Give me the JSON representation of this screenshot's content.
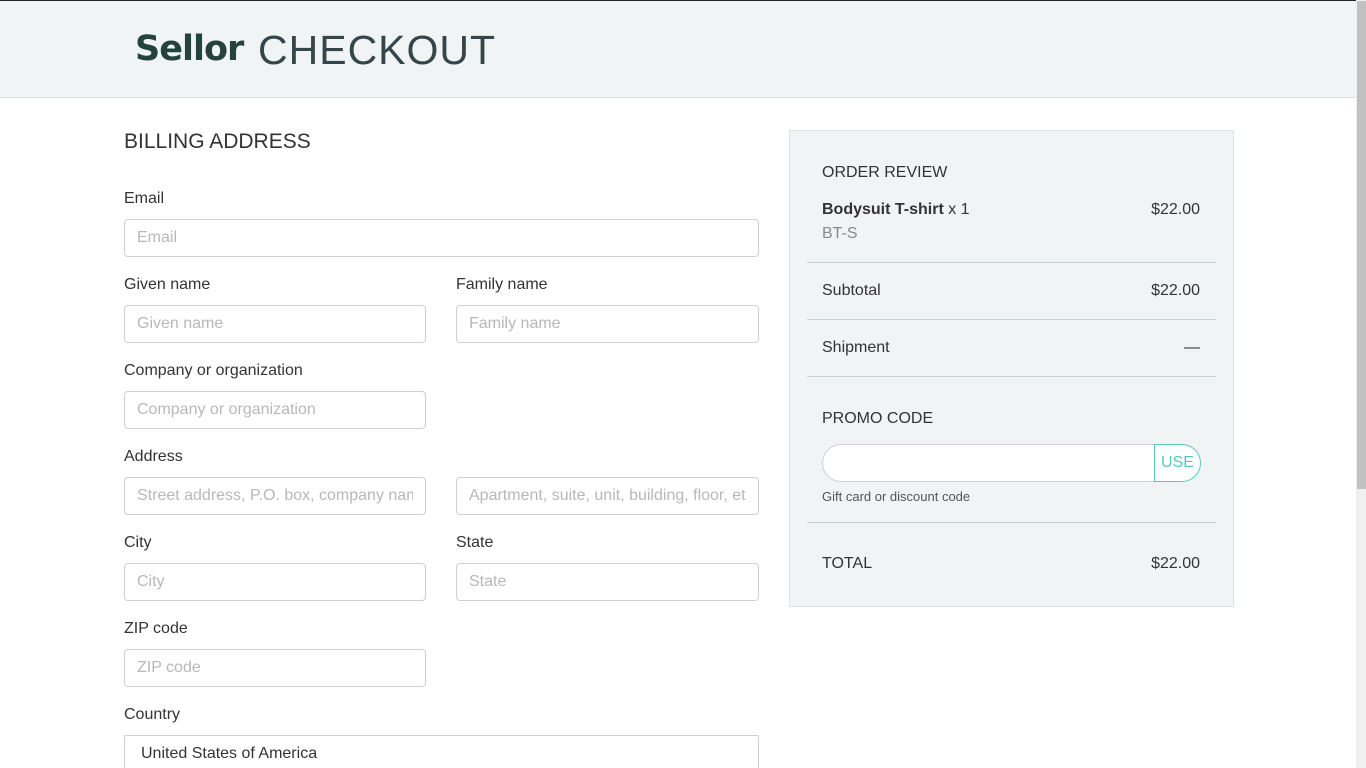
{
  "header": {
    "logo": "Sellor",
    "title": "CHECKOUT"
  },
  "billing": {
    "title": "BILLING ADDRESS",
    "email": {
      "label": "Email",
      "placeholder": "Email",
      "value": ""
    },
    "given_name": {
      "label": "Given name",
      "placeholder": "Given name",
      "value": ""
    },
    "family_name": {
      "label": "Family name",
      "placeholder": "Family name",
      "value": ""
    },
    "company": {
      "label": "Company or organization",
      "placeholder": "Company or organization",
      "value": ""
    },
    "address": {
      "label": "Address",
      "line1_placeholder": "Street address, P.O. box, company name",
      "line2_placeholder": "Apartment, suite, unit, building, floor, etc"
    },
    "city": {
      "label": "City",
      "placeholder": "City",
      "value": ""
    },
    "state": {
      "label": "State",
      "placeholder": "State",
      "value": ""
    },
    "zip": {
      "label": "ZIP code",
      "placeholder": "ZIP code",
      "value": ""
    },
    "country": {
      "label": "Country",
      "selected": "United States of America"
    }
  },
  "order_review": {
    "title": "ORDER REVIEW",
    "item": {
      "name": "Bodysuit T-shirt",
      "qty": "x 1",
      "sku": "BT-S",
      "price": "$22.00"
    },
    "subtotal": {
      "label": "Subtotal",
      "value": "$22.00"
    },
    "shipment": {
      "label": "Shipment",
      "value": "—"
    },
    "promo": {
      "title": "PROMO CODE",
      "button": "USE",
      "help": "Gift card or discount code"
    },
    "total": {
      "label": "TOTAL",
      "value": "$22.00"
    }
  },
  "colors": {
    "accent": "#57c9bd",
    "header_bg": "#f1f4f4",
    "logo": "#24433a"
  }
}
